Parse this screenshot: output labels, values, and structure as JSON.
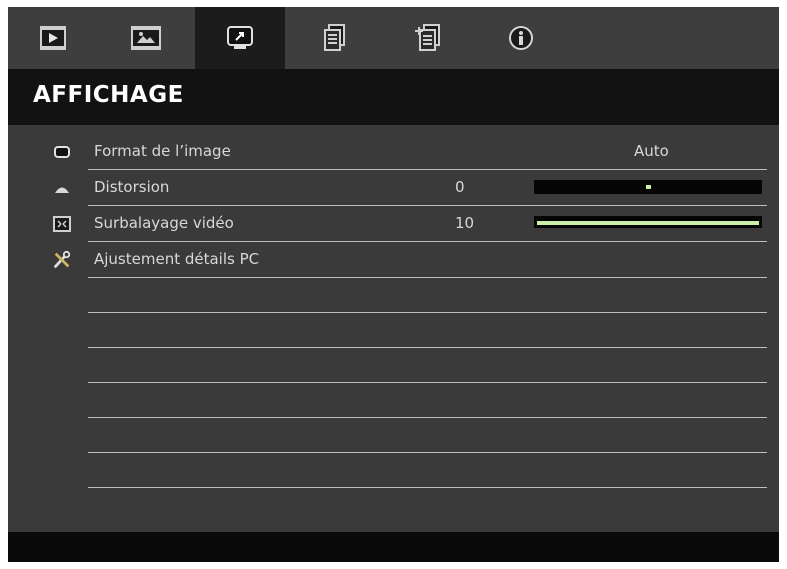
{
  "tabs": [
    {
      "icon": "play-icon"
    },
    {
      "icon": "image-icon"
    },
    {
      "icon": "display-icon",
      "active": true
    },
    {
      "icon": "document-icon"
    },
    {
      "icon": "document-settings-icon"
    },
    {
      "icon": "info-icon"
    }
  ],
  "header": {
    "title": "AFFICHAGE"
  },
  "menu": {
    "items": [
      {
        "label": "Format de l’image",
        "value": "Auto",
        "icon": "rectangle-icon"
      },
      {
        "label": "Distorsion",
        "value": "0",
        "icon": "keystone-icon",
        "level": 0.5
      },
      {
        "label": "Surbalayage vidéo",
        "value": "10",
        "icon": "overscan-icon",
        "level": 1.0
      },
      {
        "label": "Ajustement détails PC",
        "icon": "tools-icon"
      }
    ]
  },
  "colors": {
    "accent": "#c8f0a8",
    "panel": "#3a3a3a",
    "header": "#121212"
  }
}
